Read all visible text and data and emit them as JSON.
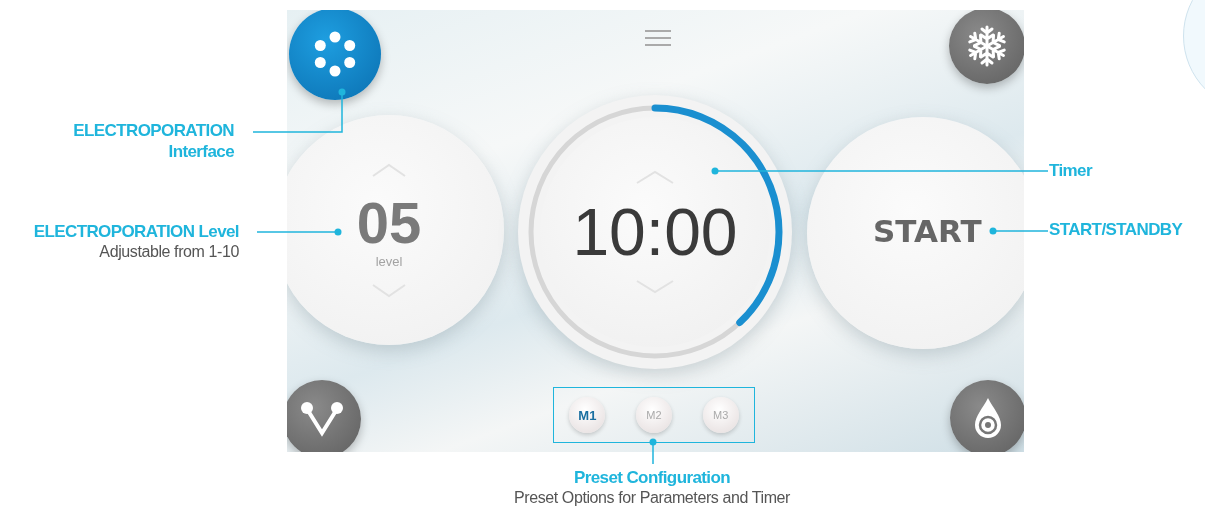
{
  "screen": {
    "level_dial": {
      "value": "05",
      "caption": "level"
    },
    "timer_dial": {
      "value": "10:00",
      "level": 0.38
    },
    "start_button": {
      "label": "START"
    },
    "presets": [
      {
        "label": "M1",
        "selected": true
      },
      {
        "label": "M2",
        "selected": false
      },
      {
        "label": "M3",
        "selected": false
      }
    ]
  },
  "callouts": [
    {
      "title": "ELECTROPORATION",
      "subtitle": "Interface"
    },
    {
      "title": "ELECTROPORATION Level",
      "description": "Adjustable from 1-10"
    },
    {
      "title": "Timer"
    },
    {
      "title": "START/STANDBY"
    },
    {
      "title": "Preset Configuration",
      "description": "Preset Options for Parameters and Timer"
    }
  ]
}
